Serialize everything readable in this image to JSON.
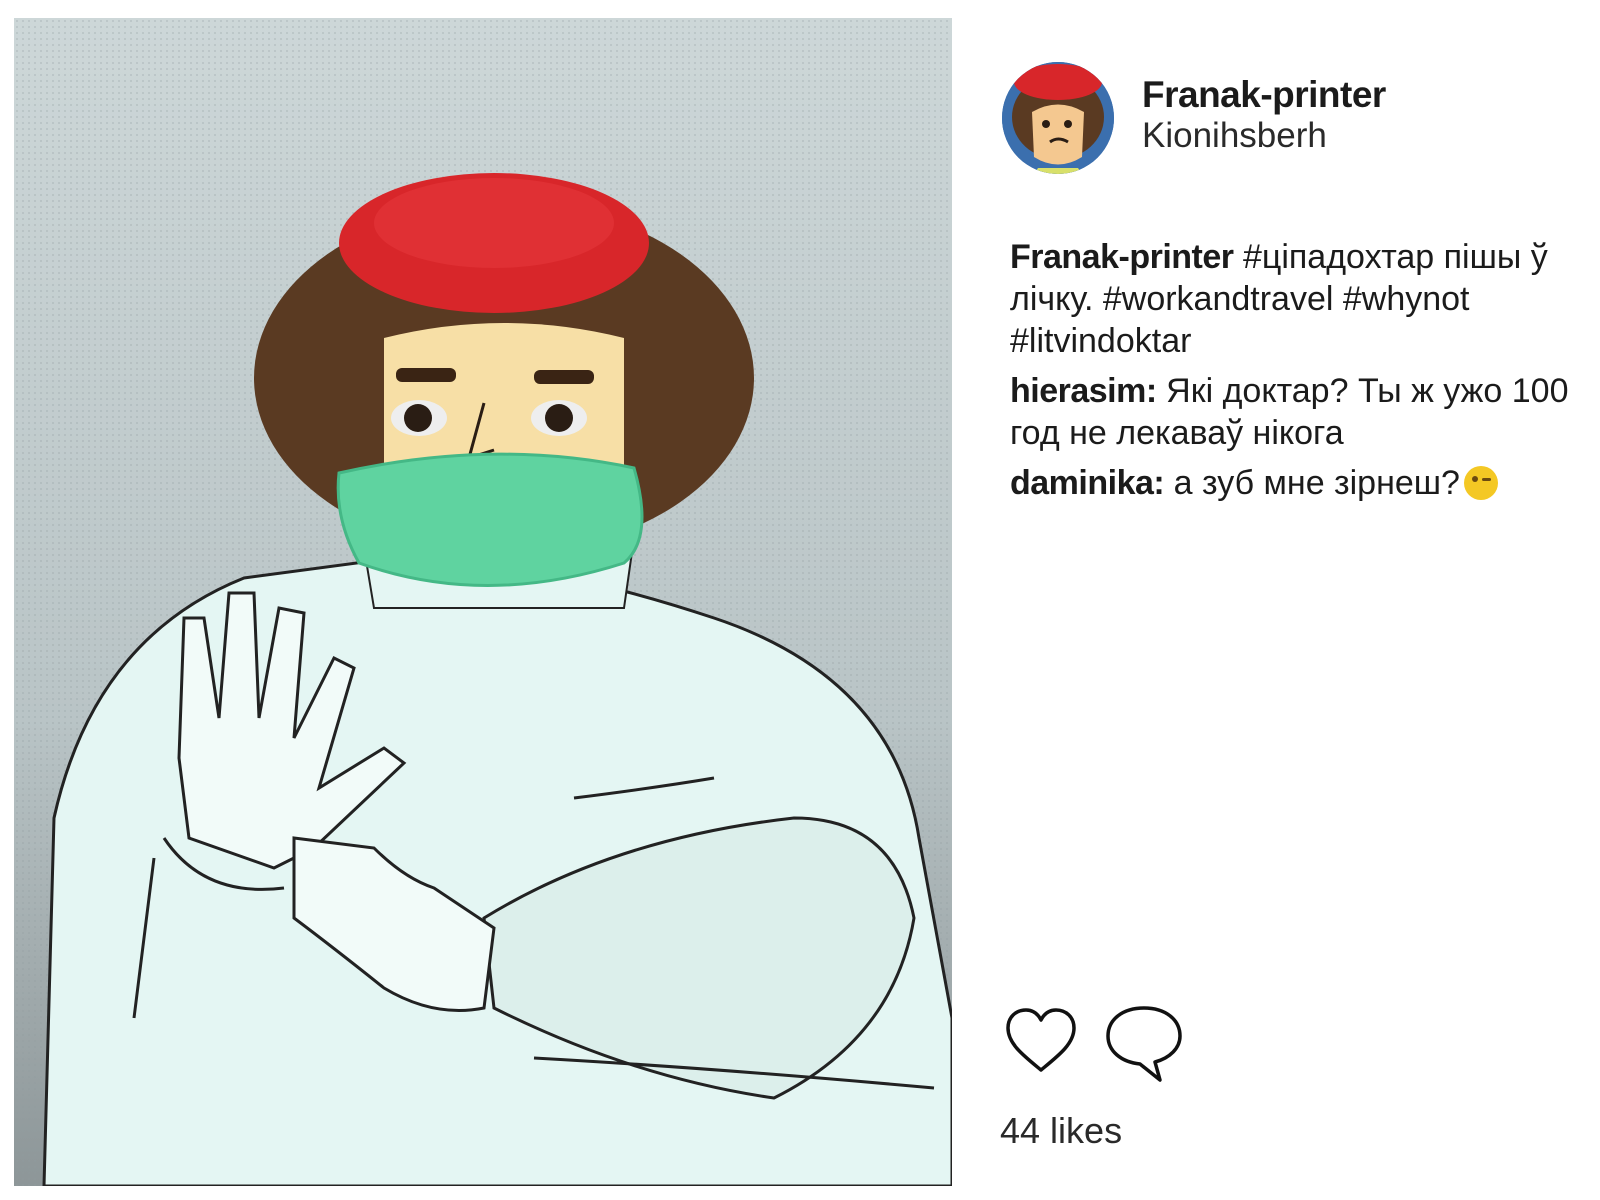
{
  "post": {
    "username": "Franak-printer",
    "location": "Kionihsberh",
    "likes_text": "44 likes"
  },
  "comments": [
    {
      "author": "Franak-printer",
      "text": "#ціпадохтар пішы ў лічку. #workandtravel #whynot #litvindoktar"
    },
    {
      "author": "hierasim:",
      "text": "Які доктар? Ты ж ужо 100 год не лекаваў нікога"
    },
    {
      "author": "daminika:",
      "text": "а зуб мне зірнеш?",
      "emoji": "wink-emoji"
    }
  ],
  "icons": [
    "heart-icon",
    "speech-bubble-icon",
    "wink-emoji"
  ],
  "colors": {
    "beret": "#d8262a",
    "mask": "#5fd3a0",
    "hair": "#5a3a22",
    "background": "#c4cfd0",
    "coat": "#e4f6f3"
  }
}
